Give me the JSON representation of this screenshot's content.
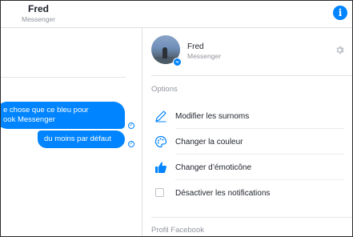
{
  "header": {
    "name": "Fred",
    "subtitle": "Messenger",
    "info_icon": "info-icon"
  },
  "conversation": {
    "messages": [
      {
        "lines": [
          "e chose que ce bleu pour",
          "ook Messenger"
        ],
        "status": "sent"
      },
      {
        "lines": [
          "du moins par défaut"
        ],
        "status": "sent"
      }
    ]
  },
  "details": {
    "name": "Fred",
    "subtitle": "Messenger",
    "settings_icon": "gear-icon",
    "options_title": "Options",
    "options": [
      {
        "icon": "pencil-icon",
        "label": "Modifier les surnoms"
      },
      {
        "icon": "palette-icon",
        "label": "Changer la couleur"
      },
      {
        "icon": "thumbs-up-icon",
        "label": "Changer d’émoticône"
      },
      {
        "icon": "checkbox-icon",
        "label": "Désactiver les notifications"
      }
    ],
    "profile_title": "Profil Facebook"
  },
  "colors": {
    "accent": "#0084ff",
    "muted_text": "#90949c",
    "divider": "#dddfe2"
  }
}
